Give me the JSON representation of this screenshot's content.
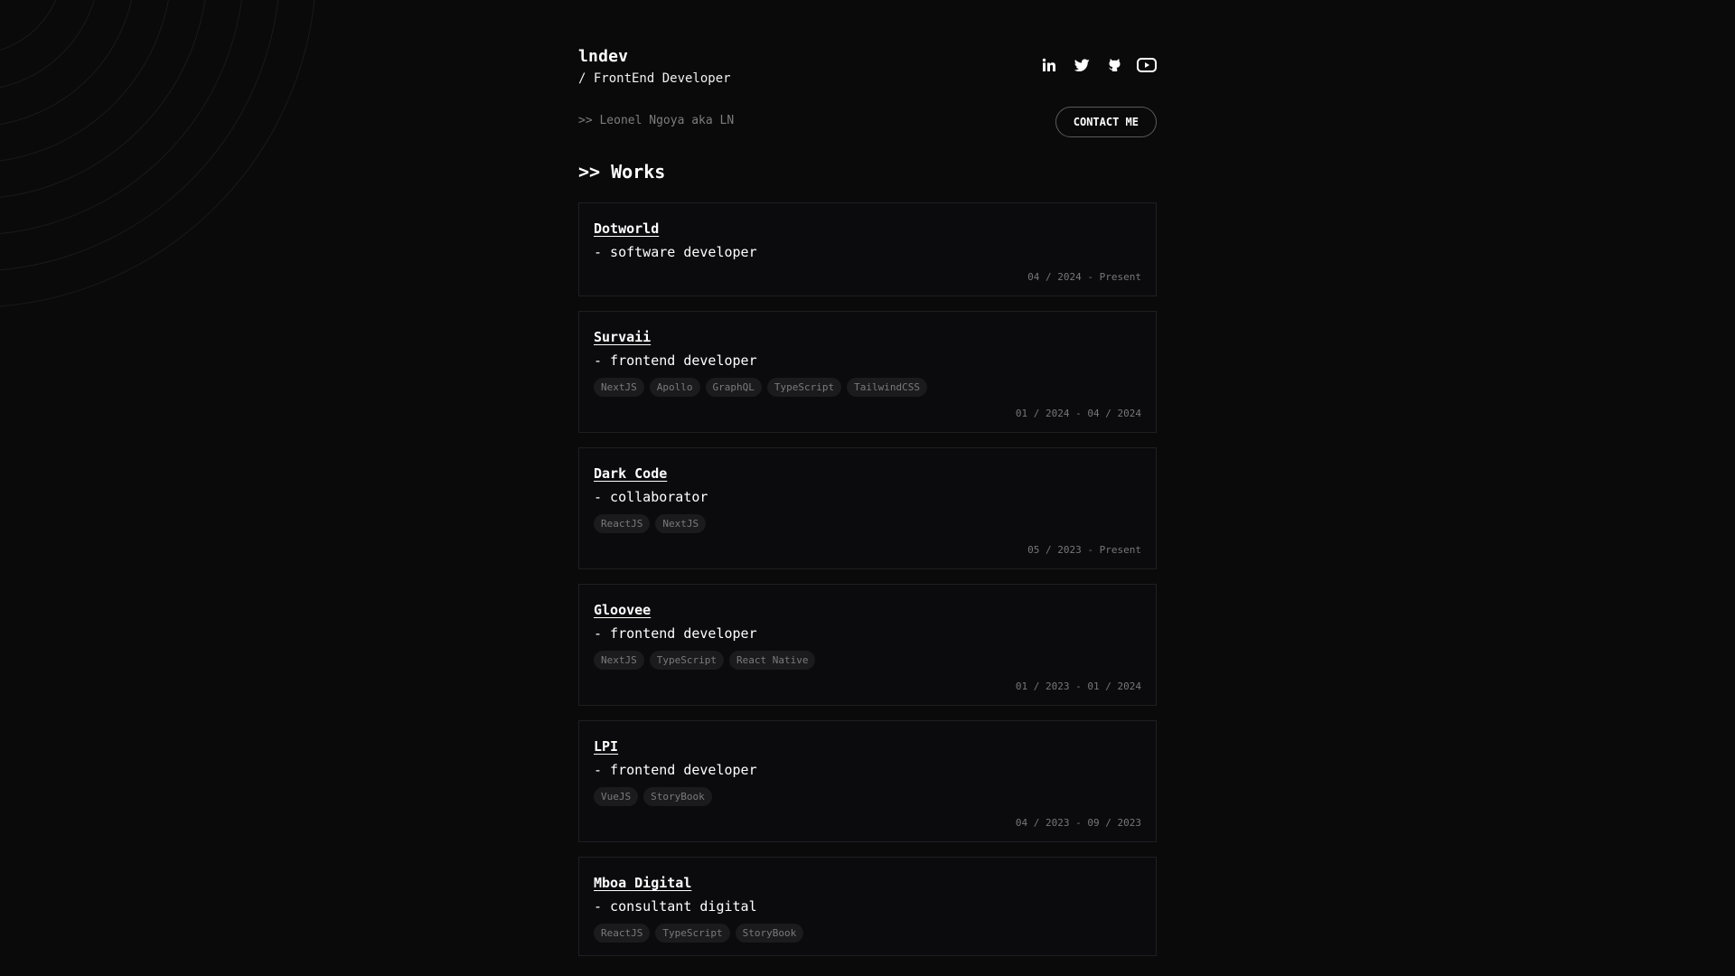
{
  "header": {
    "brand": "lndev",
    "role": "/ FrontEnd Developer",
    "subline": ">> Leonel Ngoya aka LN",
    "contact_label": "CONTACT ME",
    "socials": [
      {
        "icon": "linkedin-icon"
      },
      {
        "icon": "twitter-icon"
      },
      {
        "icon": "github-icon"
      },
      {
        "icon": "youtube-icon"
      }
    ]
  },
  "works": {
    "title": ">> Works",
    "items": [
      {
        "company": "Dotworld",
        "role": "- software developer",
        "tags": [],
        "dates": "04 / 2024 - Present"
      },
      {
        "company": "Survaii",
        "role": "- frontend developer",
        "tags": [
          "NextJS",
          "Apollo",
          "GraphQL",
          "TypeScript",
          "TailwindCSS"
        ],
        "dates": "01 / 2024 - 04 / 2024"
      },
      {
        "company": "Dark Code",
        "role": "- collaborator",
        "tags": [
          "ReactJS",
          "NextJS"
        ],
        "dates": "05 / 2023 - Present"
      },
      {
        "company": "Gloovee",
        "role": "- frontend developer",
        "tags": [
          "NextJS",
          "TypeScript",
          "React Native"
        ],
        "dates": "01 / 2023 - 01 / 2024"
      },
      {
        "company": "LPI",
        "role": "- frontend developer",
        "tags": [
          "VueJS",
          "StoryBook"
        ],
        "dates": "04 / 2023 - 09 / 2023"
      },
      {
        "company": "Mboa Digital",
        "role": "- consultant digital",
        "tags": [
          "ReactJS",
          "TypeScript",
          "StoryBook"
        ],
        "dates": ""
      }
    ]
  },
  "colors": {
    "background": "#0a0a0b",
    "card_border": "#1f1f22",
    "tag_bg": "#1b1b1e",
    "muted_text": "#777777"
  }
}
